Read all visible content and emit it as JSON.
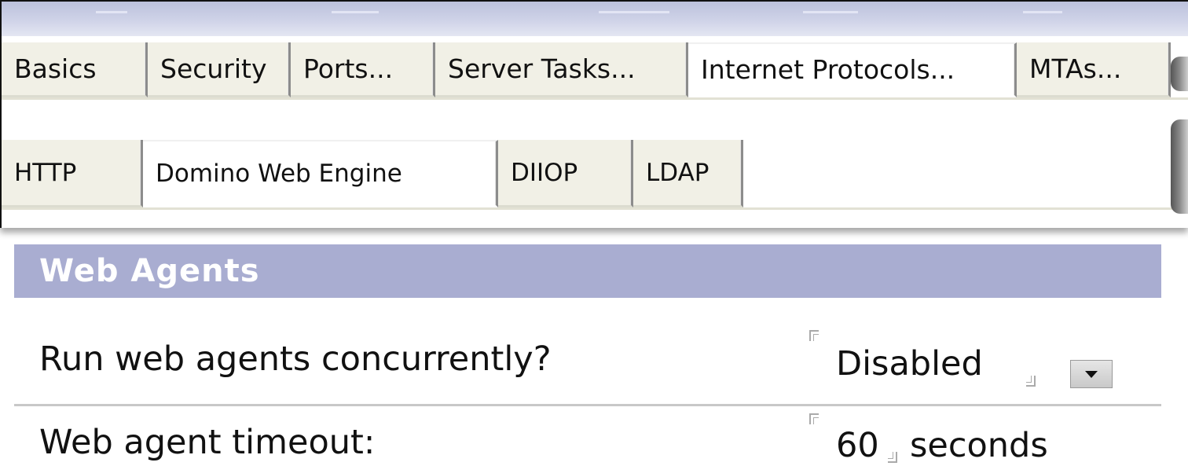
{
  "tabs": {
    "main": [
      "Basics",
      "Security",
      "Ports...",
      "Server Tasks...",
      "Internet Protocols...",
      "MTAs..."
    ],
    "main_active": "Internet Protocols...",
    "sub": [
      "HTTP",
      "Domino Web Engine",
      "DIIOP",
      "LDAP"
    ],
    "sub_active": "Domino Web Engine"
  },
  "section": {
    "title": "Web Agents"
  },
  "fields": {
    "run_concurrently": {
      "label": "Run web agents concurrently?",
      "value": "Disabled"
    },
    "timeout": {
      "label": "Web agent timeout:",
      "value": "60",
      "units": "seconds"
    }
  },
  "colors": {
    "section_header_bg": "#a9add1",
    "tab_bg": "#f1f0e6",
    "top_strip": "#c4c8e0"
  },
  "icons": {
    "dropdown": "chevron-down-icon",
    "field_bracket": "field-bracket-icon"
  }
}
